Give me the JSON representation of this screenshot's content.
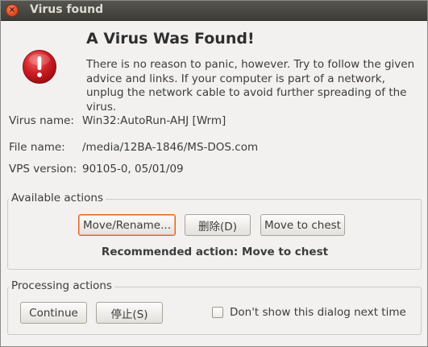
{
  "window": {
    "title": "Virus found",
    "close_glyph": "×"
  },
  "alert": {
    "icon": "error-exclamation-icon",
    "heading": "A Virus Was Found!",
    "body": "There is no reason to panic, however. Try to follow the given advice and links. If your computer is part of a network, unplug the network cable to avoid further spreading of the virus."
  },
  "details": {
    "virus_name_label": "Virus name:",
    "virus_name_value": "Win32:AutoRun-AHJ [Wrm]",
    "file_name_label": "File name:",
    "file_name_value": "/media/12BA-1846/MS-DOS.com",
    "vps_version_label": "VPS version:",
    "vps_version_value": "90105-0, 05/01/09"
  },
  "available_actions": {
    "label": "Available actions",
    "buttons": {
      "move_rename": "Move/Rename...",
      "delete": "删除(D)",
      "move_to_chest": "Move to chest"
    },
    "recommended": "Recommended action: Move to chest"
  },
  "processing_actions": {
    "label": "Processing actions",
    "buttons": {
      "continue": "Continue",
      "stop": "停止(S)"
    },
    "dont_show_label": "Don't show this dialog next time",
    "dont_show_checked": false
  },
  "colors": {
    "titlebar": "#3d3c38",
    "close_button": "#df4b1f",
    "error_icon": "#c8161d",
    "focus_ring": "#e0662a",
    "dialog_background": "#f2f1f0"
  }
}
